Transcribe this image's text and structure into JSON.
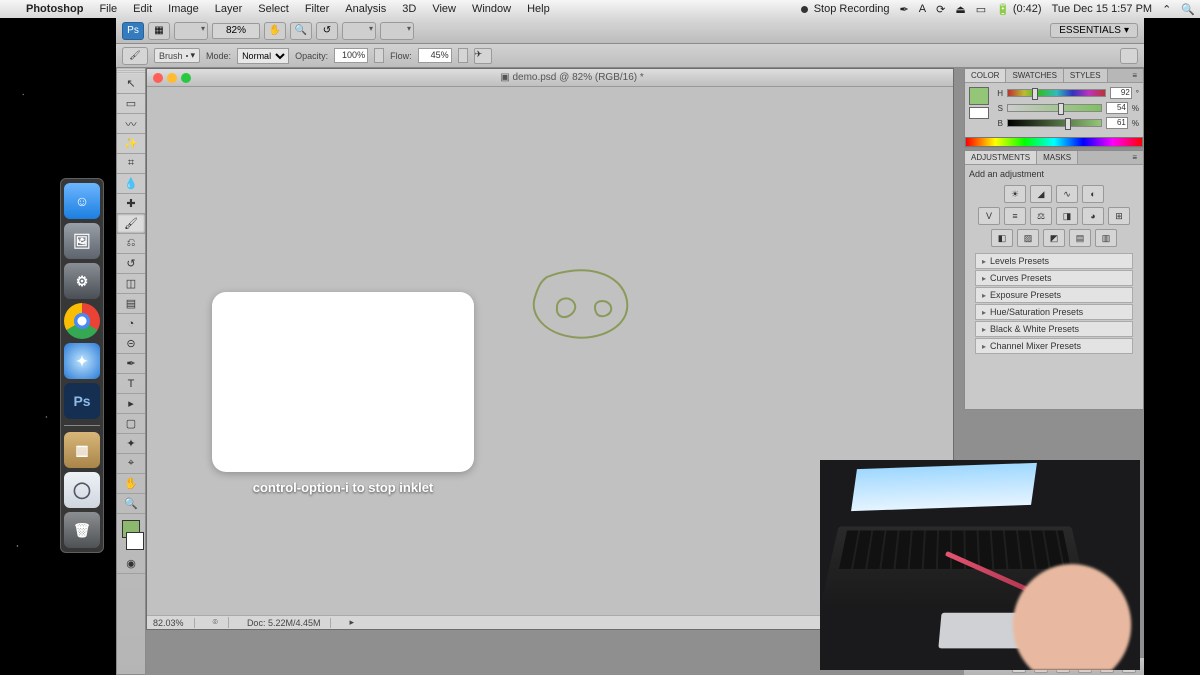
{
  "menubar": {
    "app": "Photoshop",
    "menus": [
      "File",
      "Edit",
      "Image",
      "Layer",
      "Select",
      "Filter",
      "Analysis",
      "3D",
      "View",
      "Window",
      "Help"
    ],
    "stop_recording": "Stop Recording",
    "battery": "(0:42)",
    "datetime": "Tue Dec 15  1:57 PM"
  },
  "appbar": {
    "zoom": "82%",
    "workspace": "ESSENTIALS"
  },
  "options": {
    "tool_label": "Brush",
    "mode_label": "Mode:",
    "mode_value": "Normal",
    "opacity_label": "Opacity:",
    "opacity_value": "100%",
    "flow_label": "Flow:",
    "flow_value": "45%"
  },
  "document": {
    "title": "demo.psd @ 82% (RGB/16) *",
    "status_zoom": "82.03%",
    "status_doc": "Doc: 5.22M/4.45M"
  },
  "inklet": {
    "caption": "control-option-i to stop inklet"
  },
  "panels": {
    "color": {
      "tabs": [
        "COLOR",
        "SWATCHES",
        "STYLES"
      ],
      "h_label": "H",
      "s_label": "S",
      "b_label": "B",
      "h": "92",
      "s": "54",
      "b": "61"
    },
    "adjustments": {
      "tabs": [
        "ADJUSTMENTS",
        "MASKS"
      ],
      "hint": "Add an adjustment",
      "presets": [
        "Levels Presets",
        "Curves Presets",
        "Exposure Presets",
        "Hue/Saturation Presets",
        "Black & White Presets",
        "Channel Mixer Presets"
      ]
    }
  },
  "dock": {
    "ps": "Ps"
  }
}
